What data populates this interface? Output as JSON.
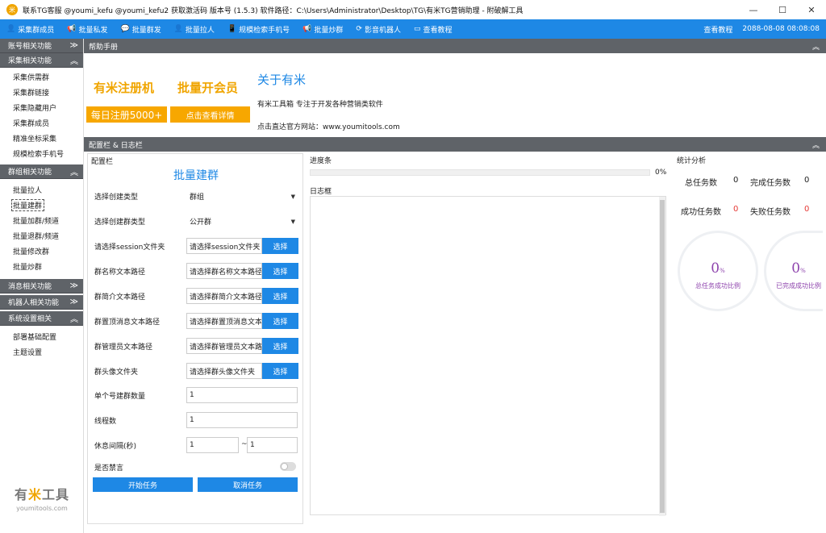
{
  "titlebar": {
    "logo": "米",
    "title": "联系TG客服 @youmi_kefu @youmi_kefu2 获取激活码 版本号 (1.5.3) 软件路径：C:\\Users\\Administrator\\Desktop\\TG\\有米TG营销助理 - 附破解工具",
    "minimize": "—",
    "maximize": "☐",
    "close": "✕"
  },
  "nav": {
    "items": [
      {
        "icon": "users-icon",
        "glyph": "👤",
        "label": "采集群成员"
      },
      {
        "icon": "megaphone-icon",
        "glyph": "📢",
        "label": "批量私发"
      },
      {
        "icon": "chat-icon",
        "glyph": "💬",
        "label": "批量群发"
      },
      {
        "icon": "user-add-icon",
        "glyph": "👤",
        "label": "批量拉人"
      },
      {
        "icon": "phone-icon",
        "glyph": "📱",
        "label": "规模检索手机号"
      },
      {
        "icon": "broadcast-icon",
        "glyph": "📢",
        "label": "批量炒群"
      },
      {
        "icon": "refresh-icon",
        "glyph": "⟳",
        "label": "影音机器人"
      },
      {
        "icon": "monitor-icon",
        "glyph": "▭",
        "label": "查看教程"
      }
    ],
    "right_link": "查看教程",
    "datetime": "2088-08-08 08:08:08"
  },
  "sidebar": {
    "groups": [
      {
        "label": "账号相关功能",
        "chevron": "≫",
        "items": []
      },
      {
        "label": "采集相关功能",
        "chevron": "︽",
        "items": [
          "采集供需群",
          "采集群链接",
          "采集隐藏用户",
          "采集群成员",
          "精准坐标采集",
          "规模检索手机号"
        ]
      },
      {
        "label": "群组相关功能",
        "chevron": "︽",
        "items": [
          "批量拉人",
          "批量建群",
          "批量加群/频道",
          "批量退群/频道",
          "批量修改群",
          "批量炒群"
        ]
      },
      {
        "label": "消息相关功能",
        "chevron": "≫",
        "items": []
      },
      {
        "label": "机器人相关功能",
        "chevron": "≫",
        "items": []
      },
      {
        "label": "系统设置相关",
        "chevron": "︽",
        "items": [
          "部署基础配置",
          "主题设置"
        ]
      }
    ],
    "active_item": "批量建群",
    "brand_part1": "有",
    "brand_part2": "米",
    "brand_part3": "工具",
    "brand_url": "youmitools.com"
  },
  "help": {
    "bar_label": "帮助手册",
    "bar_chevron": "︽",
    "promo_register": "有米注册机",
    "promo_member": "批量开会员",
    "btn_daily": "每日注册5000+",
    "btn_details": "点击查看详情",
    "about_title": "关于有米",
    "about_desc": "有米工具箱 专注于开发各种营销类软件",
    "about_site": "点击直达官方网站：www.youmitools.com"
  },
  "config": {
    "bar_label": "配置栏 & 日志栏",
    "bar_chevron": "︽",
    "panel_title": "配置栏",
    "form_title": "批量建群",
    "create_type_label": "选择创建类型",
    "create_type_value": "群组",
    "group_type_label": "选择创建群类型",
    "group_type_value": "公开群",
    "session_label": "请选择session文件夹",
    "session_placeholder": "请选择session文件夹",
    "name_label": "群名称文本路径",
    "name_placeholder": "请选择群名称文本路径",
    "intro_label": "群简介文本路径",
    "intro_placeholder": "请选择群简介文本路径",
    "pin_label": "群置顶消息文本路径",
    "pin_placeholder": "请选择群置顶消息文本路径",
    "admin_label": "群管理员文本路径",
    "admin_placeholder": "请选择群管理员文本路径",
    "avatar_label": "群头像文件夹",
    "avatar_placeholder": "请选择群头像文件夹",
    "select_btn": "选择",
    "count_label": "单个号建群数量",
    "count_value": "1",
    "threads_label": "线程数",
    "threads_value": "1",
    "rest_label": "休息间隔(秒)",
    "rest_min": "1",
    "rest_sep": "~",
    "rest_max": "1",
    "mute_label": "是否禁言",
    "mute_on": false,
    "start_btn": "开始任务",
    "cancel_btn": "取消任务"
  },
  "progress": {
    "panel_title": "进度条",
    "value": 0,
    "label": "0%"
  },
  "log": {
    "panel_title": "日志框"
  },
  "stats": {
    "panel_title": "统计分析",
    "total_label": "总任务数",
    "total_value": "0",
    "done_label": "完成任务数",
    "done_value": "0",
    "success_label": "成功任务数",
    "success_value": "0",
    "fail_label": "失败任务数",
    "fail_value": "0",
    "ratio1_value": "0",
    "ratio1_unit": "%",
    "ratio1_caption": "总任务成功比例",
    "ratio2_value": "0",
    "ratio2_unit": "%",
    "ratio2_caption": "已完成成功比例",
    "colors": {
      "accent": "#1e88e5",
      "orange": "#f7a700",
      "red": "#e53935",
      "purple": "#8e44ad",
      "gray_bar": "#5f6368"
    }
  }
}
